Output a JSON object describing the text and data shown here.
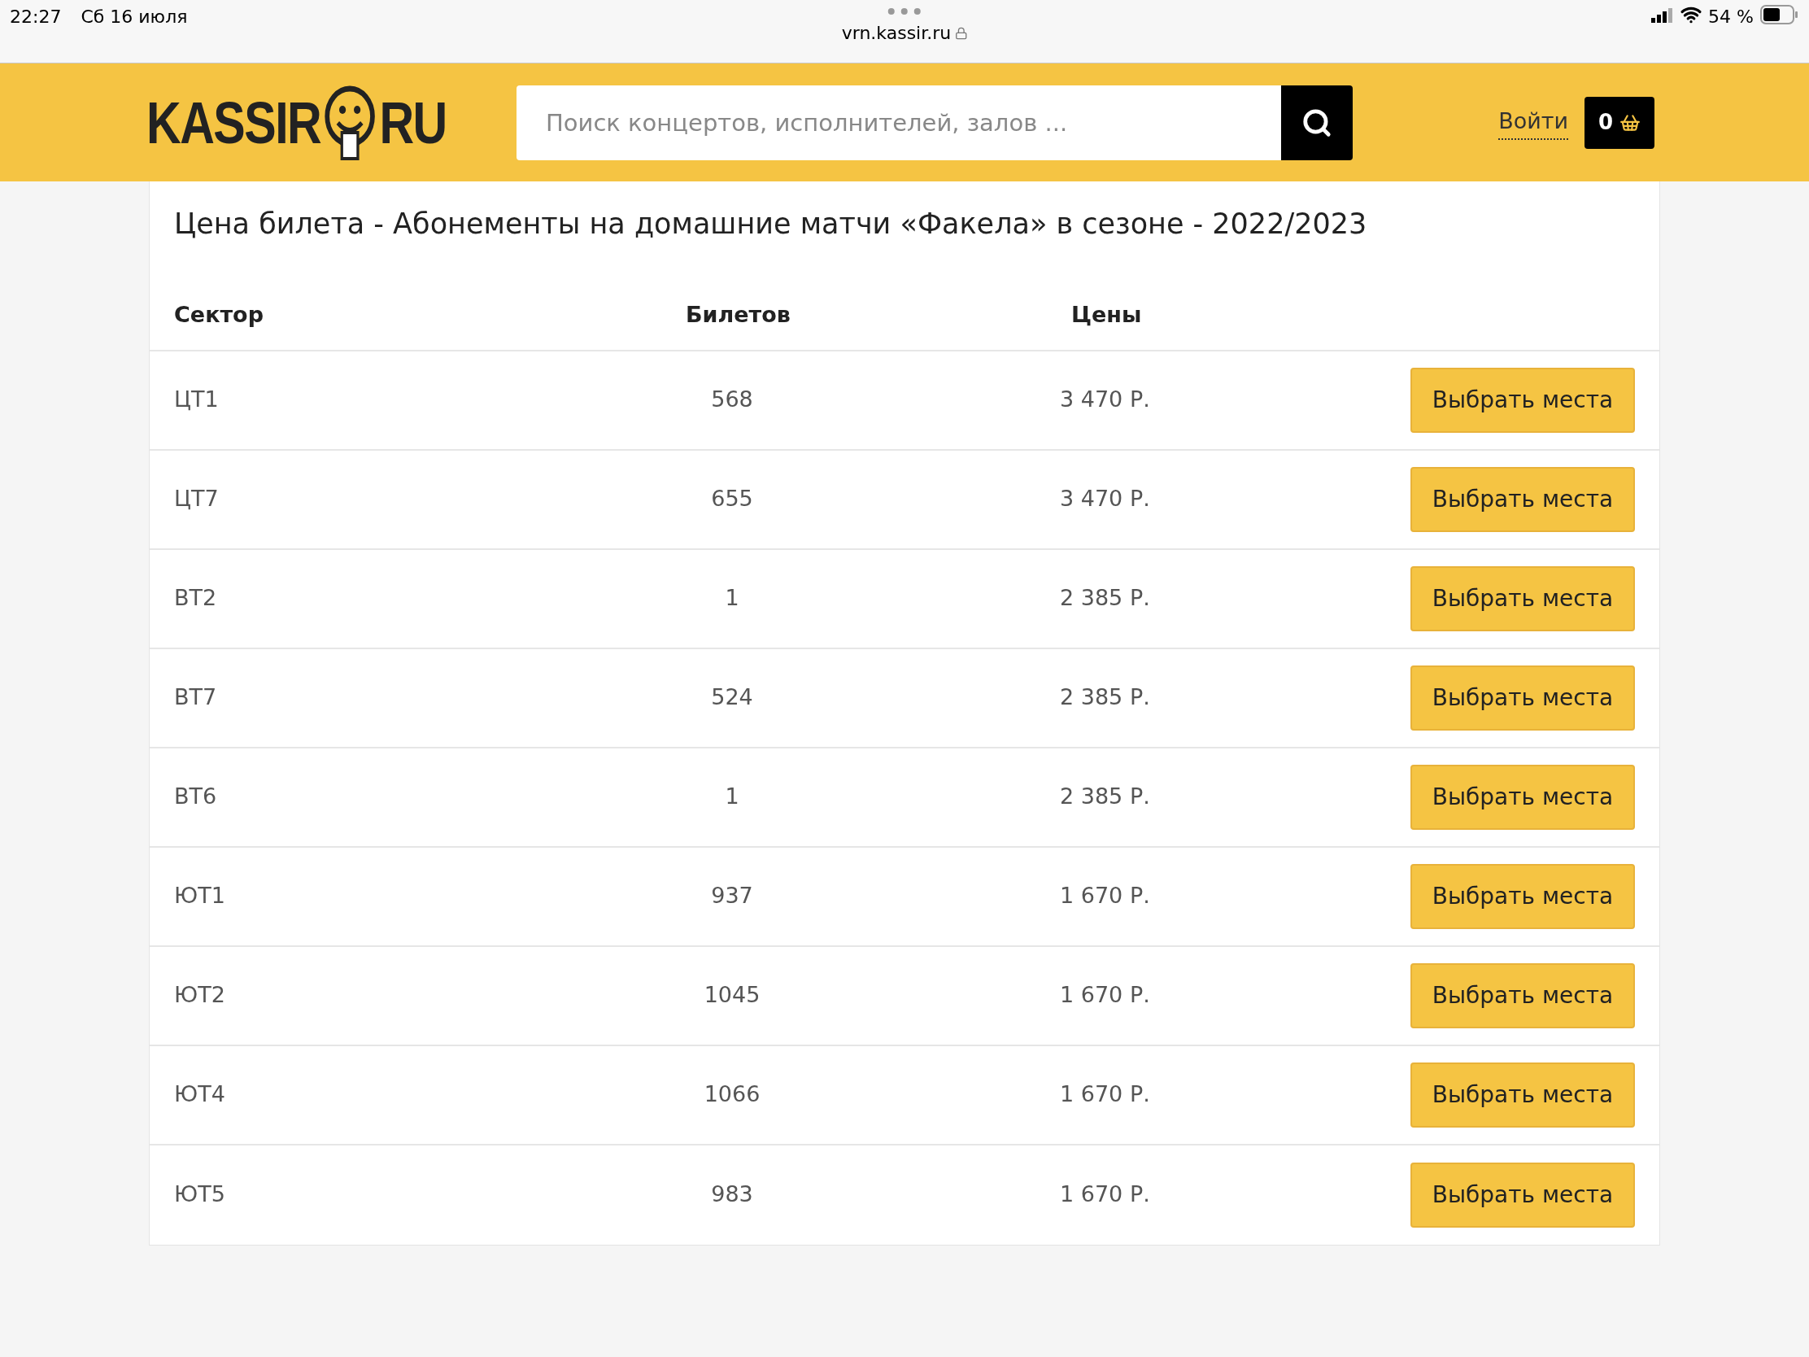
{
  "status_bar": {
    "time": "22:27",
    "date": "Сб 16 июля",
    "battery": "54 %"
  },
  "browser": {
    "url": "vrn.kassir.ru"
  },
  "header": {
    "logo": {
      "left": "KASSIR",
      "right": "RU"
    },
    "search": {
      "placeholder": "Поиск концертов, исполнителей, залов ..."
    },
    "login": "Войти",
    "cart_count": "0"
  },
  "title": "Цена билета - Абонементы на домашние матчи «Факела» в сезоне - 2022/2023",
  "table": {
    "columns": [
      "Сектор",
      "Билетов",
      "Цены"
    ],
    "rows": [
      {
        "sector": "ЦТ1",
        "tickets": "568",
        "price": "3 470 Р.",
        "action": "Выбрать места"
      },
      {
        "sector": "ЦТ7",
        "tickets": "655",
        "price": "3 470 Р.",
        "action": "Выбрать места"
      },
      {
        "sector": "ВТ2",
        "tickets": "1",
        "price": "2 385 Р.",
        "action": "Выбрать места"
      },
      {
        "sector": "ВТ7",
        "tickets": "524",
        "price": "2 385 Р.",
        "action": "Выбрать места"
      },
      {
        "sector": "ВТ6",
        "tickets": "1",
        "price": "2 385 Р.",
        "action": "Выбрать места"
      },
      {
        "sector": "ЮТ1",
        "tickets": "937",
        "price": "1 670 Р.",
        "action": "Выбрать места"
      },
      {
        "sector": "ЮТ2",
        "tickets": "1045",
        "price": "1 670 Р.",
        "action": "Выбрать места"
      },
      {
        "sector": "ЮТ4",
        "tickets": "1066",
        "price": "1 670 Р.",
        "action": "Выбрать места"
      },
      {
        "sector": "ЮТ5",
        "tickets": "983",
        "price": "1 670 Р.",
        "action": "Выбрать места"
      }
    ]
  }
}
